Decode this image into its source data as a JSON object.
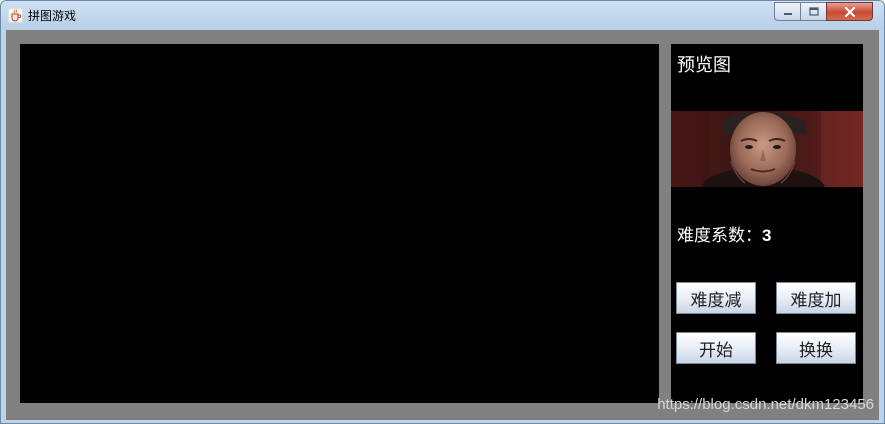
{
  "window": {
    "title": "拼图游戏",
    "app_icon": "java-coffee-cup-icon",
    "controls": [
      "minimize-icon",
      "maximize-icon",
      "close-icon"
    ]
  },
  "side_panel": {
    "preview_label": "预览图",
    "difficulty_label": "难度系数：",
    "difficulty_value": "3",
    "buttons": {
      "decrease": "难度减",
      "increase": "难度加",
      "start": "开始",
      "swap": "换换"
    }
  },
  "watermark": "https://blog.csdn.net/dkm123456",
  "colors": {
    "game_background": "#000000",
    "frame_gray": "#808080",
    "text_white": "#ffffff"
  }
}
